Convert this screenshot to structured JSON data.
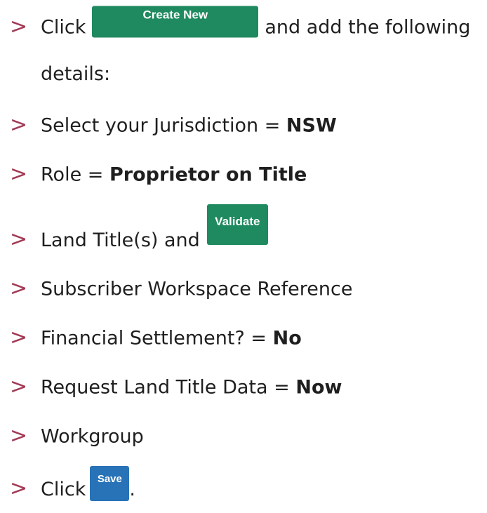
{
  "bullet_glyph": ">",
  "steps": [
    {
      "pre": "Click",
      "button": "Create New",
      "post": "and add the following",
      "continuation": "details:"
    },
    {
      "text": "Select your Jurisdiction = ",
      "bold": "NSW"
    },
    {
      "text": "Role = ",
      "bold": "Proprietor on Title"
    },
    {
      "text": "Land Title(s) and",
      "button": "Validate"
    },
    {
      "text": "Subscriber Workspace Reference"
    },
    {
      "text": "Financial Settlement? = ",
      "bold": "No"
    },
    {
      "text": "Request Land Title Data = ",
      "bold": "Now"
    },
    {
      "text": "Workgroup"
    },
    {
      "pre": "Click",
      "button": "Save",
      "post": "."
    }
  ],
  "colors": {
    "bullet": "#a23a55",
    "green_button": "#1f8a5f",
    "blue_button": "#2873b7"
  }
}
